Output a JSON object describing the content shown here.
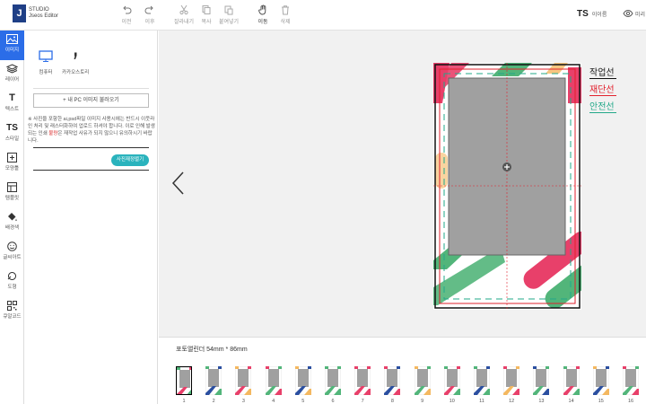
{
  "app": {
    "logo_letter": "J",
    "logo_line1": "STUDIO",
    "logo_line2": "Jseos Editor"
  },
  "toolbar": [
    {
      "label": "이전",
      "icon": "undo-icon"
    },
    {
      "label": "이후",
      "icon": "redo-icon"
    },
    {
      "label": "잘라내기",
      "icon": "scissors-icon"
    },
    {
      "label": "복사",
      "icon": "copy-icon"
    },
    {
      "label": "붙여넣기",
      "icon": "paste-icon"
    },
    {
      "label": "이동",
      "icon": "hand-icon"
    },
    {
      "label": "삭제",
      "icon": "trash-icon"
    }
  ],
  "user": {
    "initials": "TS",
    "name": "이이름"
  },
  "preview_label": "미리",
  "rail": [
    {
      "label": "이미지",
      "icon": "image-icon",
      "active": true
    },
    {
      "label": "레이어",
      "icon": "layers-icon"
    },
    {
      "label": "텍스트",
      "icon": "text-icon",
      "glyph": "T"
    },
    {
      "label": "스타일",
      "icon": "style-icon",
      "glyph": "TS"
    },
    {
      "label": "모양틀",
      "icon": "frame-icon"
    },
    {
      "label": "템플릿",
      "icon": "template-icon"
    },
    {
      "label": "배경색",
      "icon": "paint-bucket-icon"
    },
    {
      "label": "글씨아트",
      "icon": "smiley-icon"
    },
    {
      "label": "도형",
      "icon": "shape-icon"
    },
    {
      "label": "큐알코드",
      "icon": "qr-icon"
    }
  ],
  "panel": {
    "tabs": [
      {
        "label": "컴퓨터",
        "icon": "monitor-icon"
      },
      {
        "label": "카카오스토리",
        "icon": "kakaostory-icon"
      }
    ],
    "upload_button": "+ 내 PC 이미지 불러오기",
    "notice_prefix": "※ 사진을 포함한 ai,psd파일 이미지 사용시에는 반드시 이웃라인 처리 및 래스터화하여 업로드 하셔야 합니다. 이로 인해 발생되는 인쇄 ",
    "notice_highlight": "불량",
    "notice_suffix": "은 재작업 사유가 되지 않으니 유의하시기 바랍니다.",
    "load_button": "사진재정렬기"
  },
  "guide_legend": [
    {
      "label": "작업선",
      "color": "#111111"
    },
    {
      "label": "재단선",
      "color": "#e2212d"
    },
    {
      "label": "안전선",
      "color": "#22a889"
    }
  ],
  "size_label": "포토앨린더 54mm * 86mm",
  "thumbnails": [
    "1",
    "2",
    "3",
    "4",
    "5",
    "6",
    "7",
    "8",
    "9",
    "10",
    "11",
    "12",
    "13",
    "14",
    "15",
    "16"
  ],
  "selected_thumbnail": "1",
  "colors": {
    "accent": "#2b6de8",
    "pink": "#e8406a",
    "green": "#52b57a",
    "orange": "#f4b860",
    "photo": "#a0a0a0",
    "load": "#2ab3bd"
  }
}
